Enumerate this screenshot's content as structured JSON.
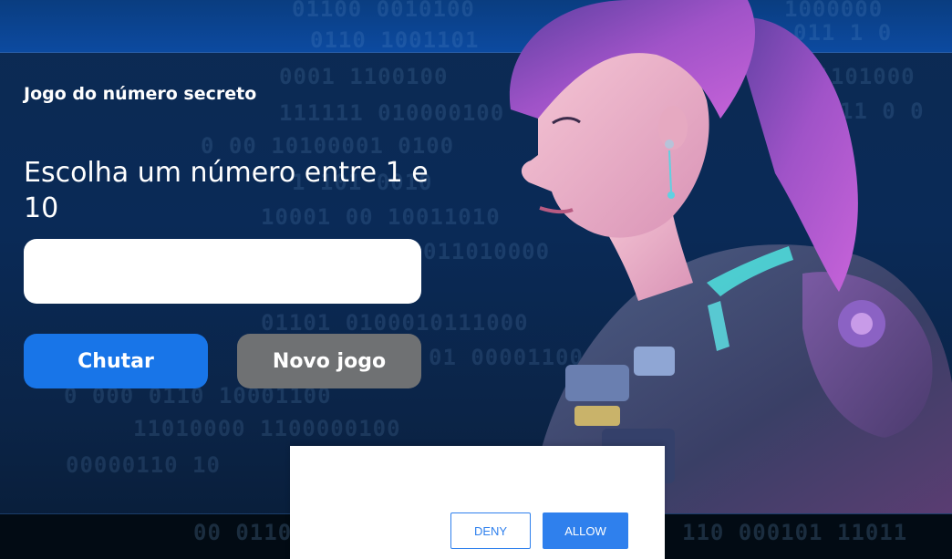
{
  "game": {
    "title": "Jogo do número secreto",
    "prompt": "Escolha um número entre 1 e 10",
    "input_value": "",
    "guess_label": "Chutar",
    "new_game_label": "Novo jogo"
  },
  "background": {
    "binary_rows": [
      "01100 0010100",
      "0110 1001101",
      "0001 1100100",
      "111111 010000100",
      "0 00 10100001 0100",
      "1 101 0010",
      "10001 00 10011010",
      "011010000",
      "01101 0100010111000",
      "01 00001100",
      "0 000 0110 10001100",
      "11010000 1100000100",
      "00000110 10",
      "00 0110",
      "1000000",
      "011 1 0",
      "01101000",
      "0011 0 0",
      "110 000101 11011"
    ]
  },
  "dialog": {
    "deny_label": "DENY",
    "allow_label": "ALLOW"
  },
  "colors": {
    "primary_button": "#1875e8",
    "secondary_button": "#6f7173",
    "dialog_accent": "#2f80ed"
  }
}
